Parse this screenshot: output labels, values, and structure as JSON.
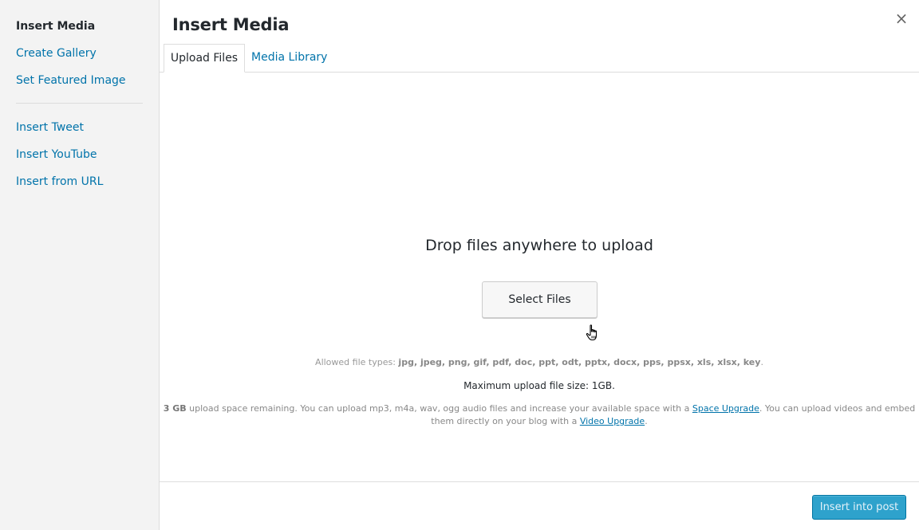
{
  "sidebar": {
    "items": [
      {
        "label": "Insert Media",
        "active": true
      },
      {
        "label": "Create Gallery"
      },
      {
        "label": "Set Featured Image"
      },
      {
        "label": "Insert Tweet"
      },
      {
        "label": "Insert YouTube"
      },
      {
        "label": "Insert from URL"
      }
    ]
  },
  "header": {
    "title": "Insert Media",
    "close_icon": "close-icon",
    "close_glyph": "×"
  },
  "tabs": [
    {
      "label": "Upload Files",
      "active": true
    },
    {
      "label": "Media Library"
    }
  ],
  "upload": {
    "drop_text": "Drop files anywhere to upload",
    "select_button": "Select Files",
    "allowed_prefix": "Allowed file types: ",
    "allowed_types": "jpg, jpeg, png, gif, pdf, doc, ppt, odt, pptx, docx, pps, ppsx, xls, xlsx, key",
    "allowed_suffix": ".",
    "max_size": "Maximum upload file size: 1GB.",
    "space_amount": "3 GB",
    "space_text_1": " upload space remaining. You can upload mp3, m4a, wav, ogg audio files and increase your available space with a ",
    "space_link_1": "Space Upgrade",
    "space_text_2": ". You can upload videos and embed them directly on your blog with a ",
    "space_link_2": "Video Upgrade",
    "space_text_3": "."
  },
  "footer": {
    "insert_button": "Insert into post"
  },
  "colors": {
    "accent": "#0073aa",
    "primary_button": "#2ea2cc",
    "sidebar_bg": "#f3f3f3"
  }
}
